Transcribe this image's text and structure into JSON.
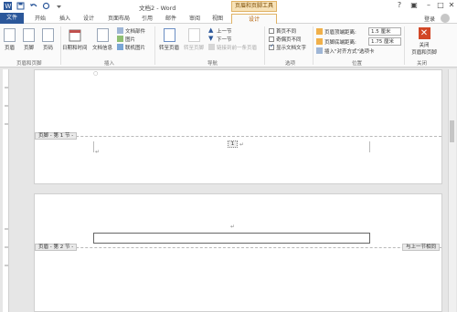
{
  "window": {
    "doc_title": "文档2 - Word",
    "context_group": "页眉和页脚工具",
    "login": "登录"
  },
  "tabs": [
    "文件",
    "开始",
    "插入",
    "设计",
    "页面布局",
    "引用",
    "邮件",
    "审阅",
    "视图",
    "设计"
  ],
  "ribbon": {
    "groups": {
      "hf": "页眉和页脚",
      "insert": "插入",
      "nav": "导航",
      "options": "选项",
      "position": "位置",
      "close": "关闭"
    },
    "buttons": {
      "header": "页眉",
      "footer": "页脚",
      "page_number": "页码",
      "datetime": "日期和时间",
      "docinfo": "文档信息",
      "docparts": "文档部件",
      "picture": "图片",
      "online_picture": "联机图片",
      "goto_header": "转至页眉",
      "goto_footer": "转至页脚",
      "prev": "上一节",
      "next": "下一节",
      "link_prev": "链接到前一条页眉",
      "first_page": "首页不同",
      "odd_even": "奇偶页不同",
      "show_text": "显示文档文字",
      "header_top": "页眉顶端距离:",
      "header_top_val": "1.5 厘米",
      "footer_bottom": "页脚底端距离:",
      "footer_bottom_val": "1.75 厘米",
      "insert_tab": "插入\"对齐方式\"选项卡",
      "close_line1": "关闭",
      "close_line2": "页眉和页脚"
    },
    "checkboxes": {
      "first_page": false,
      "odd_even": false,
      "show_text": true
    }
  },
  "document": {
    "footer_label": "页脚 - 第 1 节 -",
    "header_label": "页眉 - 第 2 节 -",
    "same_as_prev": "与上一节相同",
    "para_mark": "↵",
    "page_num_field": "1"
  },
  "colors": {
    "accent": "#2b579a",
    "context": "#f7e2b8"
  }
}
